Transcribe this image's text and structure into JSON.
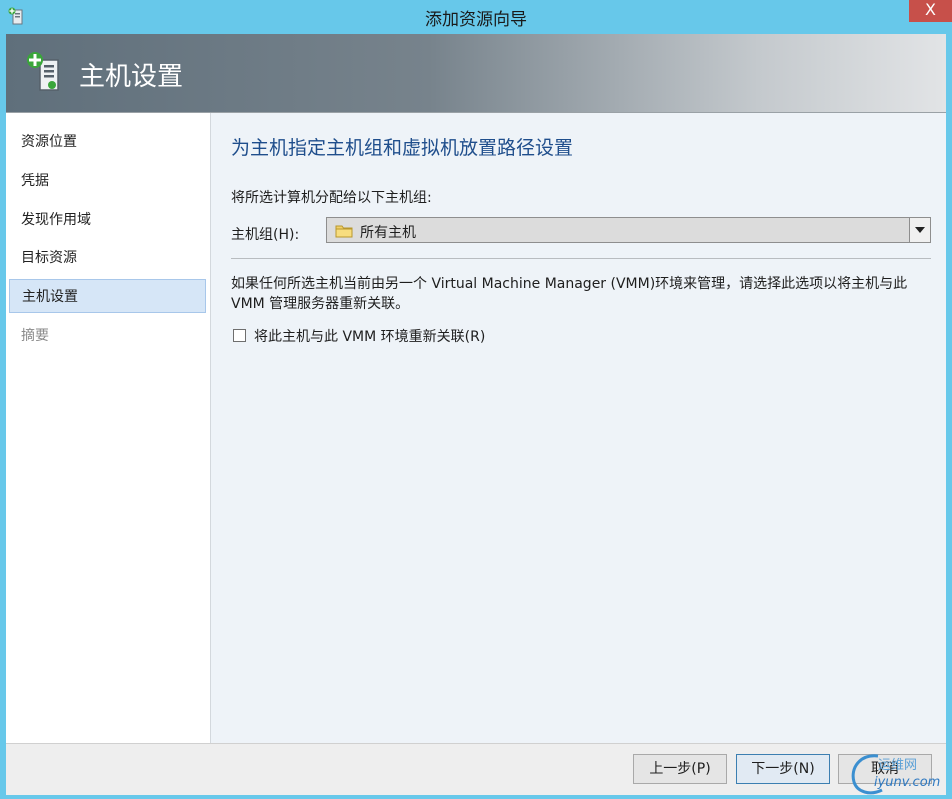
{
  "window": {
    "title": "添加资源向导",
    "close_label": "X"
  },
  "header": {
    "title": "主机设置",
    "icon": "server-add-icon"
  },
  "sidebar": {
    "items": [
      {
        "label": "资源位置",
        "state": "normal"
      },
      {
        "label": "凭据",
        "state": "normal"
      },
      {
        "label": "发现作用域",
        "state": "normal"
      },
      {
        "label": "目标资源",
        "state": "normal"
      },
      {
        "label": "主机设置",
        "state": "active"
      },
      {
        "label": "摘要",
        "state": "disabled"
      }
    ]
  },
  "main": {
    "heading": "为主机指定主机组和虚拟机放置路径设置",
    "assign_label": "将所选计算机分配给以下主机组:",
    "host_group_label": "主机组(H):",
    "host_group_value": "所有主机",
    "info_text": "如果任何所选主机当前由另一个 Virtual Machine Manager (VMM)环境来管理，请选择此选项以将主机与此 VMM 管理服务器重新关联。",
    "reassociate_label": "将此主机与此 VMM 环境重新关联(R)",
    "reassociate_checked": false
  },
  "footer": {
    "prev_label": "上一步(P)",
    "next_label": "下一步(N)",
    "cancel_label": "取消"
  },
  "watermark": {
    "line1": "运维网",
    "line2": "iyunv.com"
  },
  "colors": {
    "accent": "#1f4e8c",
    "frame": "#67c8ea",
    "active_nav": "#d6e6f7"
  }
}
